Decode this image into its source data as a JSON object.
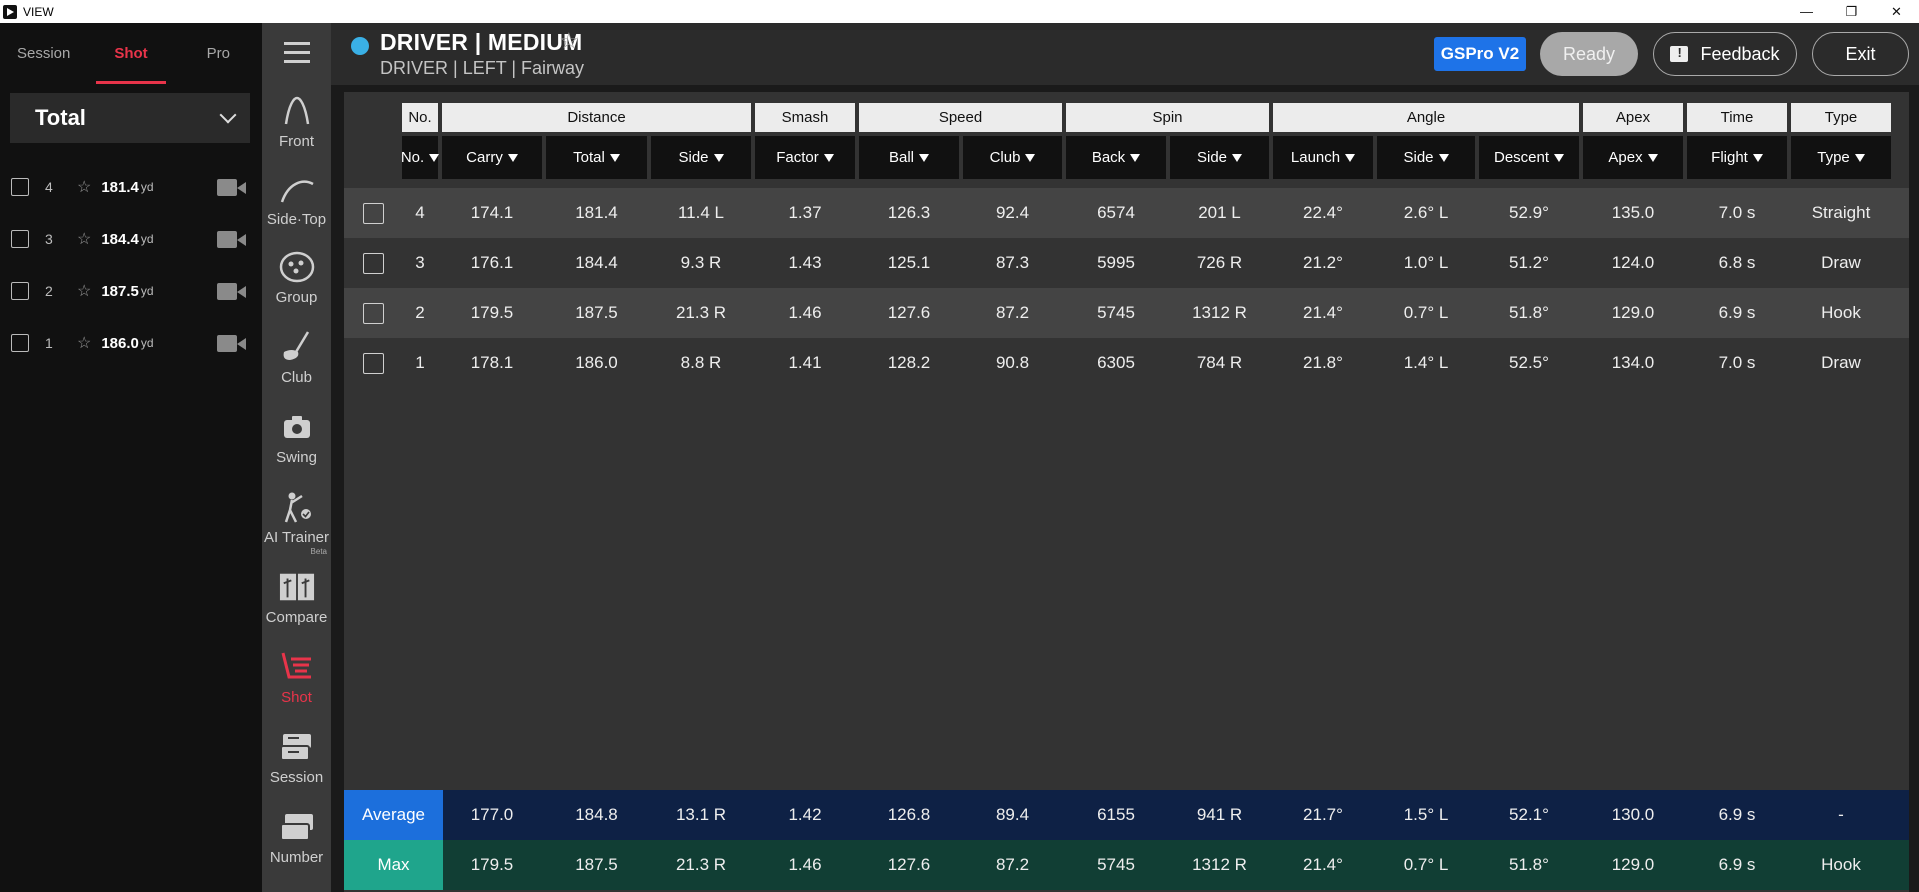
{
  "window": {
    "title": "VIEW",
    "controls": [
      "—",
      "❐",
      "✕"
    ]
  },
  "left_panel": {
    "tabs": [
      {
        "label": "Session",
        "active": false
      },
      {
        "label": "Shot",
        "active": true
      },
      {
        "label": "Pro",
        "active": false
      }
    ],
    "selector": {
      "value": "Total"
    },
    "shots": [
      {
        "no": "4",
        "distance": "181.4",
        "unit": "yd"
      },
      {
        "no": "3",
        "distance": "184.4",
        "unit": "yd"
      },
      {
        "no": "2",
        "distance": "187.5",
        "unit": "yd"
      },
      {
        "no": "1",
        "distance": "186.0",
        "unit": "yd"
      }
    ]
  },
  "nav": {
    "items": [
      {
        "label": "Front",
        "icon": "front-arc-icon"
      },
      {
        "label": "Side·Top",
        "icon": "side-top-arc-icon"
      },
      {
        "label": "Group",
        "icon": "group-icon"
      },
      {
        "label": "Club",
        "icon": "club-icon"
      },
      {
        "label": "Swing",
        "icon": "camera-icon"
      },
      {
        "label": "AI Trainer",
        "icon": "ai-trainer-icon",
        "badge": "Beta"
      },
      {
        "label": "Compare",
        "icon": "compare-icon"
      },
      {
        "label": "Shot",
        "icon": "shot-icon",
        "active": true
      },
      {
        "label": "Session",
        "icon": "session-icon"
      },
      {
        "label": "Number",
        "icon": "number-icon"
      }
    ]
  },
  "header": {
    "title": "DRIVER | MEDIUM",
    "subtitle": "DRIVER | LEFT | Fairway",
    "status_dot_color": "#3ab0e6",
    "gspro_label": "GSPro V2",
    "ready_label": "Ready",
    "feedback_label": "Feedback",
    "exit_label": "Exit"
  },
  "table": {
    "group_headers": [
      "No.",
      "Distance",
      "Smash",
      "Speed",
      "Spin",
      "Angle",
      "Apex",
      "Time",
      "Type"
    ],
    "columns": [
      "No.",
      "Carry",
      "Total",
      "Side",
      "Factor",
      "Ball",
      "Club",
      "Back",
      "Side",
      "Launch",
      "Side",
      "Descent",
      "Apex",
      "Flight",
      "Type"
    ],
    "rows": [
      {
        "cells": [
          "4",
          "174.1",
          "181.4",
          "11.4 L",
          "1.37",
          "126.3",
          "92.4",
          "6574",
          "201 L",
          "22.4°",
          "2.6° L",
          "52.9°",
          "135.0",
          "7.0 s",
          "Straight"
        ]
      },
      {
        "cells": [
          "3",
          "176.1",
          "184.4",
          "9.3 R",
          "1.43",
          "125.1",
          "87.3",
          "5995",
          "726 R",
          "21.2°",
          "1.0° L",
          "51.2°",
          "124.0",
          "6.8 s",
          "Draw"
        ]
      },
      {
        "cells": [
          "2",
          "179.5",
          "187.5",
          "21.3 R",
          "1.46",
          "127.6",
          "87.2",
          "5745",
          "1312 R",
          "21.4°",
          "0.7° L",
          "51.8°",
          "129.0",
          "6.9 s",
          "Hook"
        ]
      },
      {
        "cells": [
          "1",
          "178.1",
          "186.0",
          "8.8 R",
          "1.41",
          "128.2",
          "90.8",
          "6305",
          "784 R",
          "21.8°",
          "1.4° L",
          "52.5°",
          "134.0",
          "7.0 s",
          "Draw"
        ]
      }
    ],
    "average": {
      "label": "Average",
      "cells": [
        "177.0",
        "184.8",
        "13.1 R",
        "1.42",
        "126.8",
        "89.4",
        "6155",
        "941 R",
        "21.7°",
        "1.5° L",
        "52.1°",
        "130.0",
        "6.9 s",
        "-"
      ]
    },
    "max": {
      "label": "Max",
      "cells": [
        "179.5",
        "187.5",
        "21.3 R",
        "1.46",
        "127.6",
        "87.2",
        "5745",
        "1312 R",
        "21.4°",
        "0.7° L",
        "51.8°",
        "129.0",
        "6.9 s",
        "Hook"
      ]
    }
  }
}
